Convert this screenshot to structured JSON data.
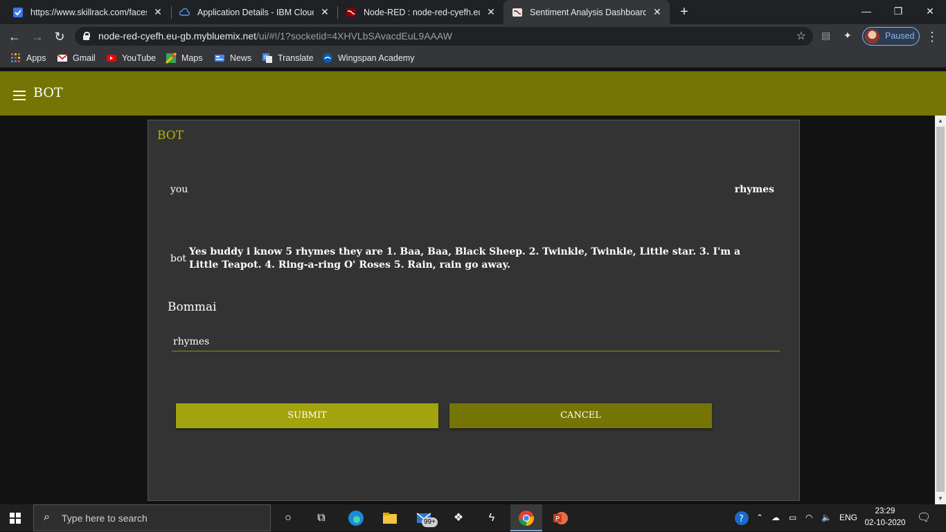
{
  "browser": {
    "tabs": [
      {
        "title": "https://www.skillrack.com/faces/u",
        "icon": "skillrack-icon"
      },
      {
        "title": "Application Details - IBM Cloud",
        "icon": "ibm-cloud-icon"
      },
      {
        "title": "Node-RED : node-red-cyefh.eu-g",
        "icon": "node-red-icon"
      },
      {
        "title": "Sentiment Analysis Dashboard",
        "icon": "node-red-icon",
        "active": true
      }
    ],
    "url_host": "node-red-cyefh.eu-gb.mybluemix.net",
    "url_rest": "/ui/#!/1?socketid=4XHVLbSAvacdEuL9AAAW",
    "profile_label": "Paused",
    "bookmarks": [
      "Apps",
      "Gmail",
      "YouTube",
      "Maps",
      "News",
      "Translate",
      "Wingspan Academy"
    ]
  },
  "app": {
    "title": "BOT",
    "card_title": "BOT",
    "chat": {
      "you_label": "you",
      "you_message": "rhymes",
      "bot_label": "bot",
      "bot_message": "Yes buddy i know 5 rhymes they are 1. Baa, Baa, Black Sheep. 2. Twinkle, Twinkle, Little star. 3. I'm a Little Teapot. 4. Ring-a-ring O' Roses 5. Rain, rain go away."
    },
    "form": {
      "label": "Bommai",
      "input_value": "rhymes",
      "submit_label": "SUBMIT",
      "cancel_label": "CANCEL"
    },
    "colors": {
      "accent": "#757505",
      "submit": "#a3a30e",
      "card": "#333333",
      "title": "#b3b30f"
    }
  },
  "taskbar": {
    "search_placeholder": "Type here to search",
    "mail_badge": "99+",
    "language": "ENG",
    "time": "23:29",
    "date": "02-10-2020"
  }
}
